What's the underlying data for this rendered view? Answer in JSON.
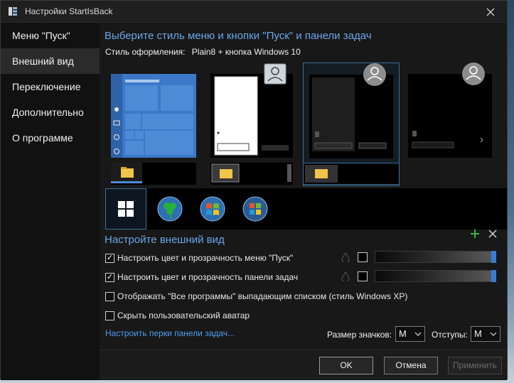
{
  "window": {
    "title": "Настройки StartIsBack"
  },
  "sidebar": {
    "items": [
      {
        "label": "Меню \"Пуск\""
      },
      {
        "label": "Внешний вид"
      },
      {
        "label": "Переключение"
      },
      {
        "label": "Дополнительно"
      },
      {
        "label": "О программе"
      }
    ],
    "active_index": 1
  },
  "appearance": {
    "heading": "Выберите стиль меню и кнопки \"Пуск\" и панели задач",
    "style_label": "Стиль оформления:",
    "style_value": "Plain8 + кнопка Windows 10",
    "styles": [
      {
        "icon": "windows10-tiles-preview"
      },
      {
        "icon": "classic-white-menu-preview"
      },
      {
        "icon": "dark-menu-preview"
      },
      {
        "icon": "plain-black-menu-preview"
      }
    ],
    "start_buttons": [
      {
        "icon": "windows10-logo-icon"
      },
      {
        "icon": "clover-orb-icon"
      },
      {
        "icon": "windows7-orb-icon"
      },
      {
        "icon": "windows-orb-icon"
      }
    ],
    "selected_style_index": 2,
    "selected_button_index": 0
  },
  "customize": {
    "heading": "Настройте внешний вид",
    "options": [
      {
        "label": "Настроить цвет и прозрачность меню \"Пуск\"",
        "checked": true,
        "checkmark": "✓"
      },
      {
        "label": "Настроить цвет и прозрачность панели задач",
        "checked": true,
        "checkmark": "✓"
      },
      {
        "label": "Отображать \"Все программы\" выпадающим списком (стиль Windows XP)",
        "checked": false,
        "checkmark": ""
      },
      {
        "label": "Скрыть пользовательский аватар",
        "checked": false,
        "checkmark": ""
      }
    ],
    "opacity": {
      "start_menu": 1.0,
      "taskbar": 1.0
    },
    "taskbar_perks_link": "Настроить перки панели задач...",
    "icon_size_label": "Размер значков:",
    "icon_size_value": "M",
    "spacing_label": "Отступы:",
    "spacing_value": "M"
  },
  "footer": {
    "ok": "OK",
    "cancel": "Отмена",
    "apply": "Применить"
  },
  "colors": {
    "accent": "#6aa6e8",
    "link": "#4f9ef0",
    "selection_border": "#3f6f95",
    "slider_thumb": "#3a7bd5",
    "plus": "#35b54a"
  }
}
